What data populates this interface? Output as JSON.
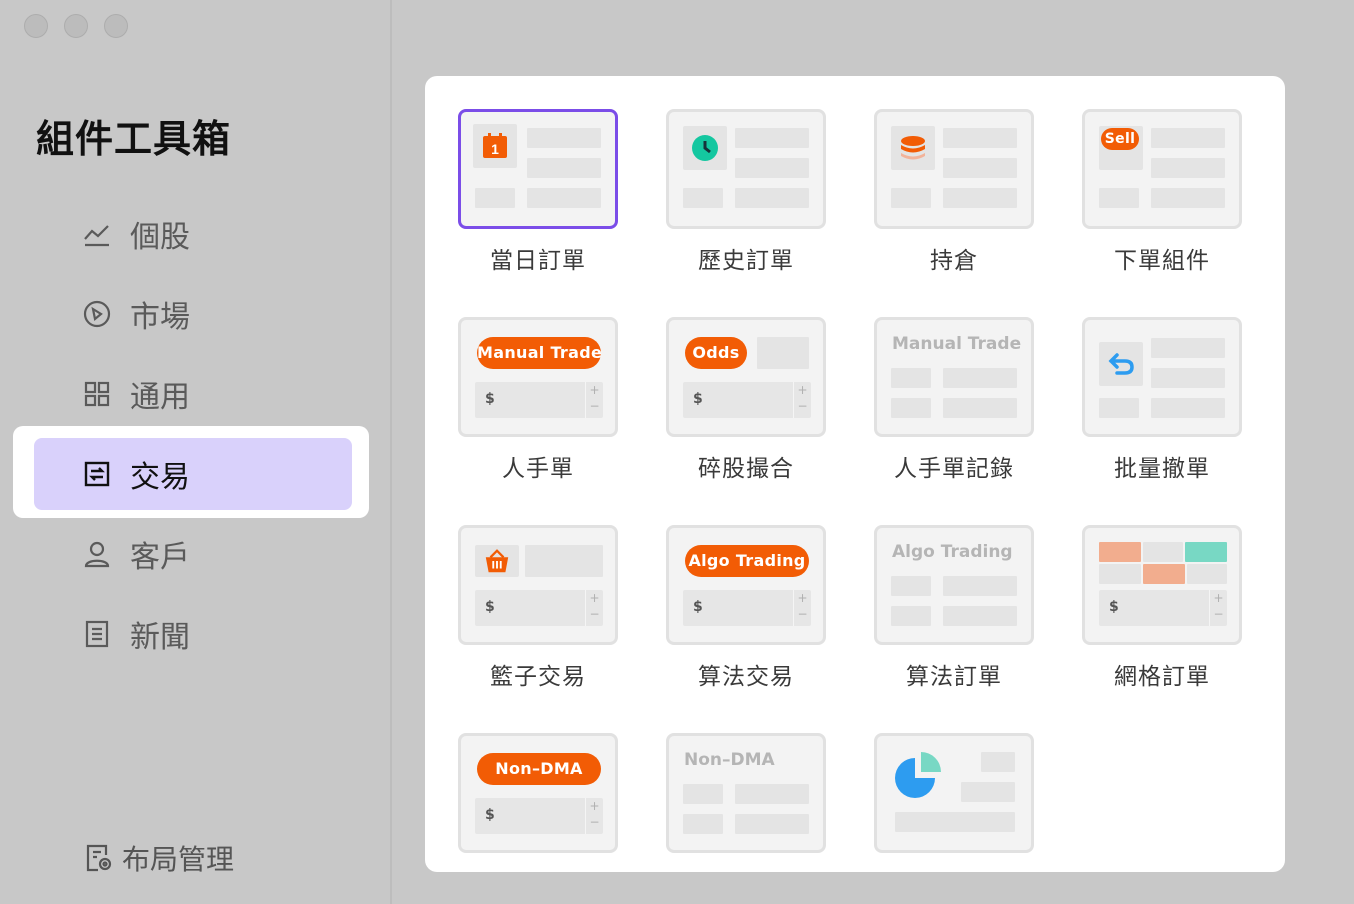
{
  "sidebar": {
    "title": "組件工具箱",
    "items": [
      {
        "label": "個股",
        "icon": "chart-line-icon"
      },
      {
        "label": "市場",
        "icon": "compass-icon"
      },
      {
        "label": "通用",
        "icon": "grid-icon"
      },
      {
        "label": "交易",
        "icon": "trade-icon",
        "active": true
      },
      {
        "label": "客戶",
        "icon": "user-icon"
      },
      {
        "label": "新聞",
        "icon": "news-icon"
      }
    ],
    "layout_manager": "布局管理"
  },
  "tiles": [
    {
      "label": "當日訂單",
      "selected": true
    },
    {
      "label": "歷史訂單"
    },
    {
      "label": "持倉"
    },
    {
      "label": "下單組件",
      "badge": "Sell"
    },
    {
      "label": "人手單",
      "badge": "Manual Trade"
    },
    {
      "label": "碎股撮合",
      "badge": "Odds"
    },
    {
      "label": "人手單記錄",
      "ghost": "Manual Trade"
    },
    {
      "label": "批量撤單"
    },
    {
      "label": "籃子交易"
    },
    {
      "label": "算法交易",
      "badge": "Algo Trading"
    },
    {
      "label": "算法訂單",
      "ghost": "Algo Trading"
    },
    {
      "label": "網格訂單"
    },
    {
      "label": "",
      "badge": "Non–DMA"
    },
    {
      "label": "",
      "ghost": "Non–DMA"
    },
    {
      "label": ""
    }
  ],
  "input": {
    "currency": "$",
    "plus": "+",
    "minus": "−"
  },
  "calendar_day": "1",
  "colors": {
    "accent": "#f25c05",
    "selection": "#7b4de8",
    "nav_active_bg": "#d9d1fb",
    "teal": "#14c7a0",
    "blue": "#2d9cf0"
  }
}
